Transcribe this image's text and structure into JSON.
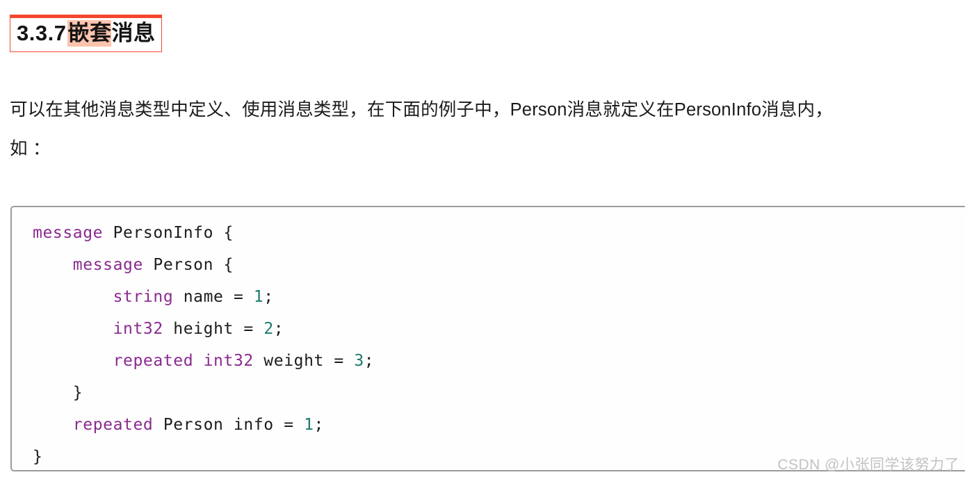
{
  "heading": {
    "number": "3.3.7",
    "title_highlight": "嵌套",
    "title_rest": "消息",
    "border_color": "#ef4b33",
    "top_border_color": "#f4462c",
    "highlight_color": "#fcc3ad"
  },
  "paragraph": {
    "line1": "可以在其他消息类型中定义、使用消息类型，在下面的例子中，Person消息就定义在PersonInfo消息内，",
    "line2": "如 ："
  },
  "code": {
    "language": "protobuf",
    "keyword_color": "#8a2a8f",
    "number_color": "#1a7a70",
    "border_color": "#9b9b9b",
    "lines": [
      {
        "indent": 0,
        "tokens": [
          {
            "t": "message",
            "k": "kw"
          },
          {
            "t": " PersonInfo {",
            "k": "pl"
          }
        ]
      },
      {
        "indent": 1,
        "tokens": [
          {
            "t": "message",
            "k": "kw"
          },
          {
            "t": " Person {",
            "k": "pl"
          }
        ]
      },
      {
        "indent": 2,
        "tokens": [
          {
            "t": "string",
            "k": "kw"
          },
          {
            "t": " name = ",
            "k": "pl"
          },
          {
            "t": "1",
            "k": "num"
          },
          {
            "t": ";",
            "k": "pl"
          }
        ]
      },
      {
        "indent": 2,
        "tokens": [
          {
            "t": "int32",
            "k": "kw"
          },
          {
            "t": " height = ",
            "k": "pl"
          },
          {
            "t": "2",
            "k": "num"
          },
          {
            "t": ";",
            "k": "pl"
          }
        ]
      },
      {
        "indent": 2,
        "tokens": [
          {
            "t": "repeated",
            "k": "kw"
          },
          {
            "t": " ",
            "k": "pl"
          },
          {
            "t": "int32",
            "k": "kw"
          },
          {
            "t": " weight = ",
            "k": "pl"
          },
          {
            "t": "3",
            "k": "num"
          },
          {
            "t": ";",
            "k": "pl"
          }
        ]
      },
      {
        "indent": 1,
        "tokens": [
          {
            "t": "}",
            "k": "pl"
          }
        ]
      },
      {
        "indent": 1,
        "tokens": [
          {
            "t": "repeated",
            "k": "kw"
          },
          {
            "t": " Person info = ",
            "k": "pl"
          },
          {
            "t": "1",
            "k": "num"
          },
          {
            "t": ";",
            "k": "pl"
          }
        ]
      },
      {
        "indent": 0,
        "tokens": [
          {
            "t": "}",
            "k": "pl"
          }
        ]
      }
    ],
    "plain_text": "message PersonInfo {\n    message Person {\n        string name = 1;\n        int32 height = 2;\n        repeated int32 weight = 3;\n    }\n    repeated Person info = 1;\n}"
  },
  "watermark": {
    "text": "CSDN @小张同学该努力了",
    "color": "#c2c2c2"
  }
}
